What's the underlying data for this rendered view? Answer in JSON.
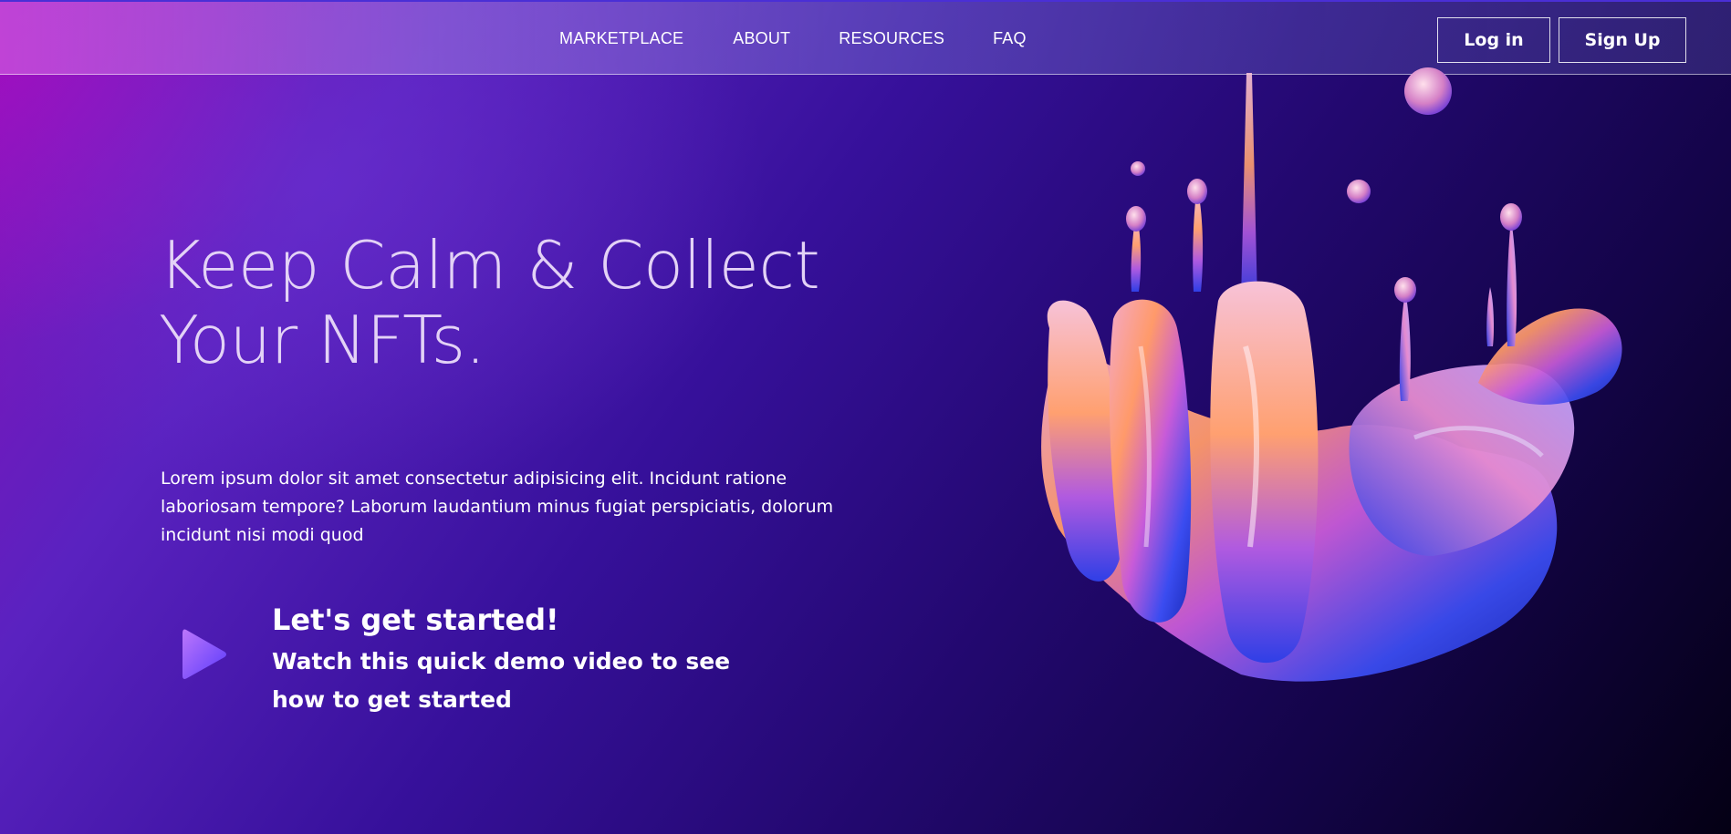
{
  "nav": {
    "links": [
      "MARKETPLACE",
      "ABOUT",
      "RESOURCES",
      "FAQ"
    ],
    "login_label": "Log in",
    "signup_label": "Sign Up"
  },
  "hero": {
    "title_line1": "Keep Calm & Collect",
    "title_line2": "Your NFTs.",
    "description": "Lorem ipsum dolor sit amet consectetur adipisicing elit. Incidunt ratione laboriosam tempore? Laborum laudantium minus fugiat perspiciatis, dolorum incidunt nisi modi quod"
  },
  "cta": {
    "title": "Let's get started!",
    "subtitle": "Watch this quick demo video to see how to get started",
    "icon": "play-icon"
  },
  "illustration": {
    "icon": "liquid-splash-illustration"
  },
  "colors": {
    "bg_magenta": "#8a10b8",
    "bg_purple": "#36109a",
    "bg_dark": "#040014",
    "title_color": "#e3d2f6",
    "play_gradient_start": "#b46cff",
    "play_gradient_end": "#5a3bff"
  }
}
